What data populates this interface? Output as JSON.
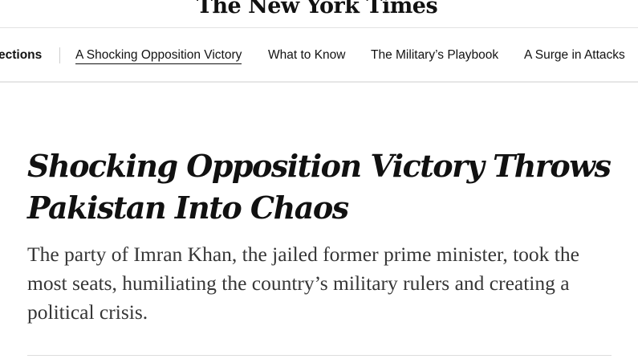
{
  "masthead": {
    "logo_text": "The New York Times"
  },
  "nav": {
    "section_label": "ections",
    "items": [
      {
        "label": "A Shocking Opposition Victory",
        "active": true
      },
      {
        "label": "What to Know",
        "active": false
      },
      {
        "label": "The Military’s Playbook",
        "active": false
      },
      {
        "label": "A Surge in Attacks",
        "active": false
      }
    ]
  },
  "article": {
    "headline": "Shocking Opposition Victory Throws Pakistan Into Chaos",
    "summary": "The party of Imran Khan, the jailed former prime minister, took the most seats, humiliating the country’s military rulers and creating a political crisis."
  }
}
